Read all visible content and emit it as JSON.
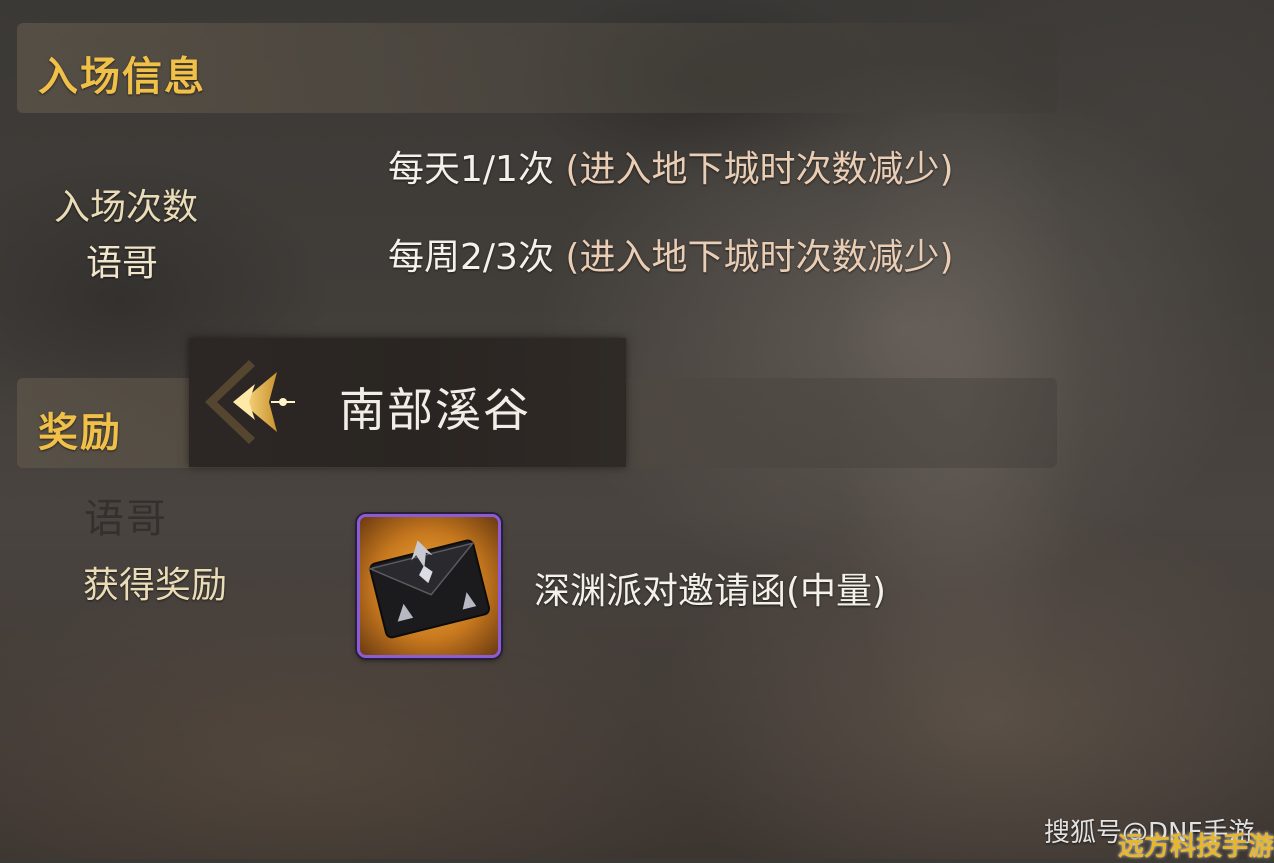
{
  "entry_section": {
    "title": "入场信息",
    "count_label": "入场次数",
    "overlay_text": "语哥",
    "lines": [
      {
        "main": "每天1/1次",
        "note": "(进入地下城时次数减少)"
      },
      {
        "main": "每周2/3次",
        "note": "(进入地下城时次数减少)"
      }
    ]
  },
  "reward_section": {
    "title": "奖励",
    "faint_text": "语哥",
    "gain_label": "获得奖励",
    "item": {
      "icon": "envelope-icon",
      "name": "深渊派对邀请函(中量)",
      "frame_color": "#8a5cd6"
    }
  },
  "nav": {
    "back_icon": "chevron-back-icon",
    "location": "南部溪谷"
  },
  "watermarks": {
    "source": "搜狐号@DNF手游",
    "site": "远方科技手游网"
  },
  "colors": {
    "section_title": "#f0c048",
    "label": "#ebdcb8",
    "note": "#e9cdb4"
  }
}
